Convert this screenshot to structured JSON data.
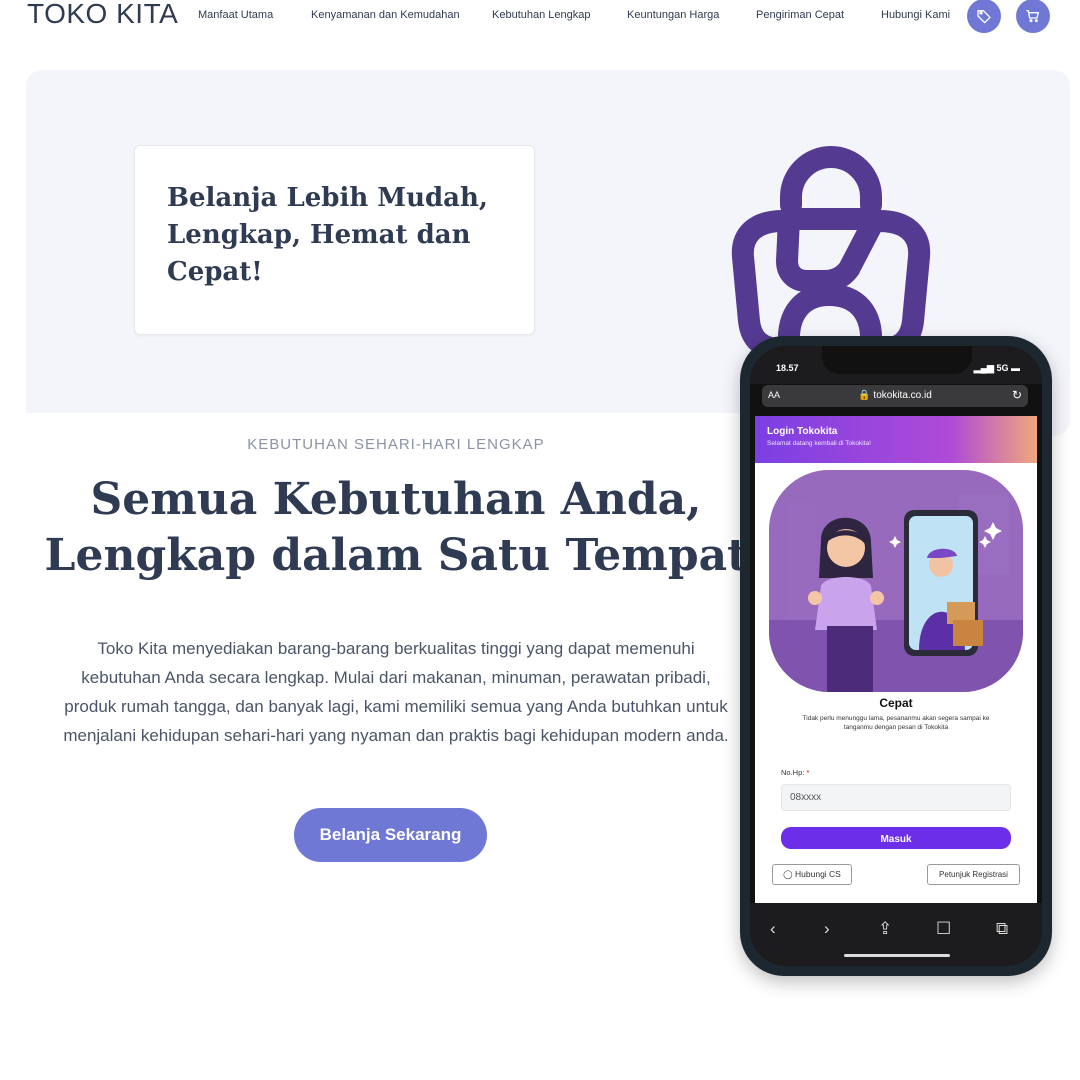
{
  "header": {
    "brand": "TOKO KITA",
    "nav": [
      "Manfaat Utama",
      "Kenyamanan dan Kemudahan",
      "Kebutuhan Lengkap",
      "Keuntungan Harga",
      "Pengiriman Cepat",
      "Hubungi Kami"
    ],
    "icons": [
      "tag-icon",
      "cart-icon"
    ]
  },
  "hero": {
    "title": "Belanja Lebih Mudah, Lengkap, Hemat dan Cepat!"
  },
  "section": {
    "eyebrow": "KEBUTUHAN SEHARI-HARI LENGKAP",
    "title": "Semua Kebutuhan Anda, Lengkap dalam Satu Tempat",
    "body": "Toko Kita menyediakan barang-barang berkualitas tinggi yang dapat memenuhi kebutuhan Anda secara lengkap. Mulai dari makanan, minuman, perawatan pribadi, produk rumah tangga, dan banyak lagi, kami memiliki semua yang Anda butuhkan untuk menjalani kehidupan sehari-hari yang nyaman dan praktis bagi kehidupan modern anda.",
    "cta": "Belanja Sekarang"
  },
  "phone": {
    "time": "18.57",
    "signal": "5G",
    "aa": "AA",
    "url": "tokokita.co.id",
    "login_title": "Login Tokokita",
    "login_subtitle": "Selamat datang kembali di Tokokita!",
    "feature_title": "Cepat",
    "feature_desc": "Tidak perlu menunggu lama, pesananmu akan segera sampai ke tanganmu dengan pesan di Tokokita",
    "field_label": "No.Hp:",
    "required_mark": "*",
    "field_placeholder": "08xxxx",
    "submit": "Masuk",
    "cs_button": "Hubungi CS",
    "reg_button": "Petunjuk Registrasi"
  },
  "colors": {
    "accent": "#6f79d5",
    "bag": "#553a92",
    "text": "#2f3b52",
    "hero_bg": "#f4f5fb",
    "phone_accent": "#6c2ee8"
  }
}
